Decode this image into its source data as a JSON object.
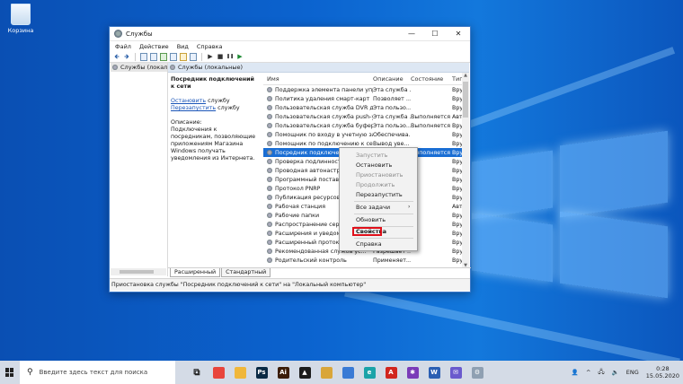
{
  "desktop": {
    "icons": [
      {
        "label": "Корзина",
        "icon": "recycle-bin-icon"
      }
    ]
  },
  "window": {
    "title": "Службы",
    "controls": {
      "minimize": "—",
      "maximize": "☐",
      "close": "✕"
    },
    "menu": [
      "Файл",
      "Действие",
      "Вид",
      "Справка"
    ],
    "toolbar": {
      "back": "🡸",
      "forward": "🡺",
      "play": "▶",
      "stop": "■",
      "pause": "❚❚",
      "restart": "▶"
    },
    "tree": {
      "item": "Службы (локальн"
    },
    "header": "Службы (локальные)",
    "description": {
      "heading": "Посредник подключений к сети",
      "stop_link": "Остановить",
      "stop_suffix": " службу",
      "restart_link": "Перезапустить",
      "restart_suffix": " службу",
      "label": "Описание:",
      "text": "Подключения к посредникам, позволяющие приложениям Магазина Windows получать уведомления из Интернета."
    },
    "columns": {
      "name": "Имя",
      "description": "Описание",
      "status": "Состояние",
      "type": "Тип"
    },
    "rows": [
      {
        "name": "Поддержка элемента панели управле...",
        "desc": "Эта служба ...",
        "status": "",
        "type": "Вру"
      },
      {
        "name": "Политика удаления смарт-карт",
        "desc": "Позволяет ...",
        "status": "",
        "type": "Вру"
      },
      {
        "name": "Пользовательская служба DVR для игр и ...",
        "desc": "Эта пользо...",
        "status": "",
        "type": "Вру"
      },
      {
        "name": "Пользовательская служба push-уведомл...",
        "desc": "Эта служба ...",
        "status": "Выполняется",
        "type": "Авт"
      },
      {
        "name": "Пользовательская служба буфера обмe...",
        "desc": "Эта пользо...",
        "status": "Выполняется",
        "type": "Вру"
      },
      {
        "name": "Помощник по входу в учетную запись ...",
        "desc": "Обеспечива...",
        "status": "",
        "type": "Вру"
      },
      {
        "name": "Помощник по подключению к сети",
        "desc": "Вывод уве...",
        "status": "",
        "type": "Вру"
      },
      {
        "name": "Посредник подключений к с",
        "desc": "",
        "status": "Выполняется",
        "type": "Вру",
        "selected": true
      },
      {
        "name": "Проверка подлинности на с",
        "desc": "",
        "status": "",
        "type": "Вру"
      },
      {
        "name": "Проводная автонастройка",
        "desc": "",
        "status": "",
        "type": "Вру"
      },
      {
        "name": "Программный поставщик те",
        "desc": "",
        "status": "",
        "type": "Вру"
      },
      {
        "name": "Протокол PNRP",
        "desc": "",
        "status": "",
        "type": "Вру"
      },
      {
        "name": "Публикация ресурсов обнар",
        "desc": "",
        "status": "",
        "type": "Вру"
      },
      {
        "name": "Рабочая станция",
        "desc": "",
        "status": "",
        "type": "Авт"
      },
      {
        "name": "Рабочие папки",
        "desc": "",
        "status": "",
        "type": "Вру"
      },
      {
        "name": "Распространение сертифика",
        "desc": "",
        "status": "",
        "type": "Вру"
      },
      {
        "name": "Расширения и уведомления",
        "desc": "",
        "status": "",
        "type": "Вру"
      },
      {
        "name": "Расширенный протокол про",
        "desc": "",
        "status": "",
        "type": "Вру"
      },
      {
        "name": "Рекомендованная служба ус...",
        "desc": "Разрешает ...",
        "status": "",
        "type": "Вру"
      },
      {
        "name": "Родительский контроль",
        "desc": "Применяет...",
        "status": "",
        "type": "Вру"
      }
    ],
    "tabs": [
      "Расширенный",
      "Стандартный"
    ],
    "status": "Приостановка службы \"Посредник подключений к сети\" на \"Локальный компьютер\""
  },
  "context_menu": {
    "items": [
      {
        "label": "Запустить",
        "enabled": false
      },
      {
        "label": "Остановить",
        "enabled": true
      },
      {
        "label": "Приостановить",
        "enabled": false
      },
      {
        "label": "Продолжить",
        "enabled": false
      },
      {
        "label": "Перезапустить",
        "enabled": true
      },
      {
        "label": "Все задачи",
        "enabled": true,
        "submenu": "›"
      },
      {
        "label": "Обновить",
        "enabled": true
      },
      {
        "label": "Свойства",
        "enabled": true,
        "bold": true,
        "highlighted": true
      },
      {
        "label": "Справка",
        "enabled": true
      }
    ]
  },
  "taskbar": {
    "search_placeholder": "Введите здесь текст для поиска",
    "apps": [
      {
        "icon": "task-view-icon",
        "glyph": "⧉",
        "color": "#d4dbe6"
      },
      {
        "icon": "chrome-icon",
        "glyph": "",
        "color": "#e8453c"
      },
      {
        "icon": "file-explorer-icon",
        "glyph": "",
        "color": "#f0b73a"
      },
      {
        "icon": "photoshop-icon",
        "glyph": "Ps",
        "color": "#0a2a44"
      },
      {
        "icon": "illustrator-icon",
        "glyph": "Ai",
        "color": "#3b1d08"
      },
      {
        "icon": "media-icon",
        "glyph": "▲",
        "color": "#1c1c1c"
      },
      {
        "icon": "folder-icon",
        "glyph": "",
        "color": "#d9a63a"
      },
      {
        "icon": "photos-icon",
        "glyph": "",
        "color": "#3a7bd5"
      },
      {
        "icon": "edge-icon",
        "glyph": "e",
        "color": "#1aa3a8"
      },
      {
        "icon": "acrobat-icon",
        "glyph": "A",
        "color": "#d1261e"
      },
      {
        "icon": "onenote-icon",
        "glyph": "✱",
        "color": "#7a3bb8"
      },
      {
        "icon": "word-icon",
        "glyph": "W",
        "color": "#2b5fb3"
      },
      {
        "icon": "mail-icon",
        "glyph": "✉",
        "color": "#6a5acd"
      },
      {
        "icon": "services-icon",
        "glyph": "⚙",
        "color": "#8fa0b2"
      }
    ],
    "tray": {
      "people": "👤",
      "chevron": "^",
      "network": "🖧",
      "volume": "🔈",
      "language": "ENG",
      "time": "0:28",
      "date": "15.05.2020"
    }
  }
}
